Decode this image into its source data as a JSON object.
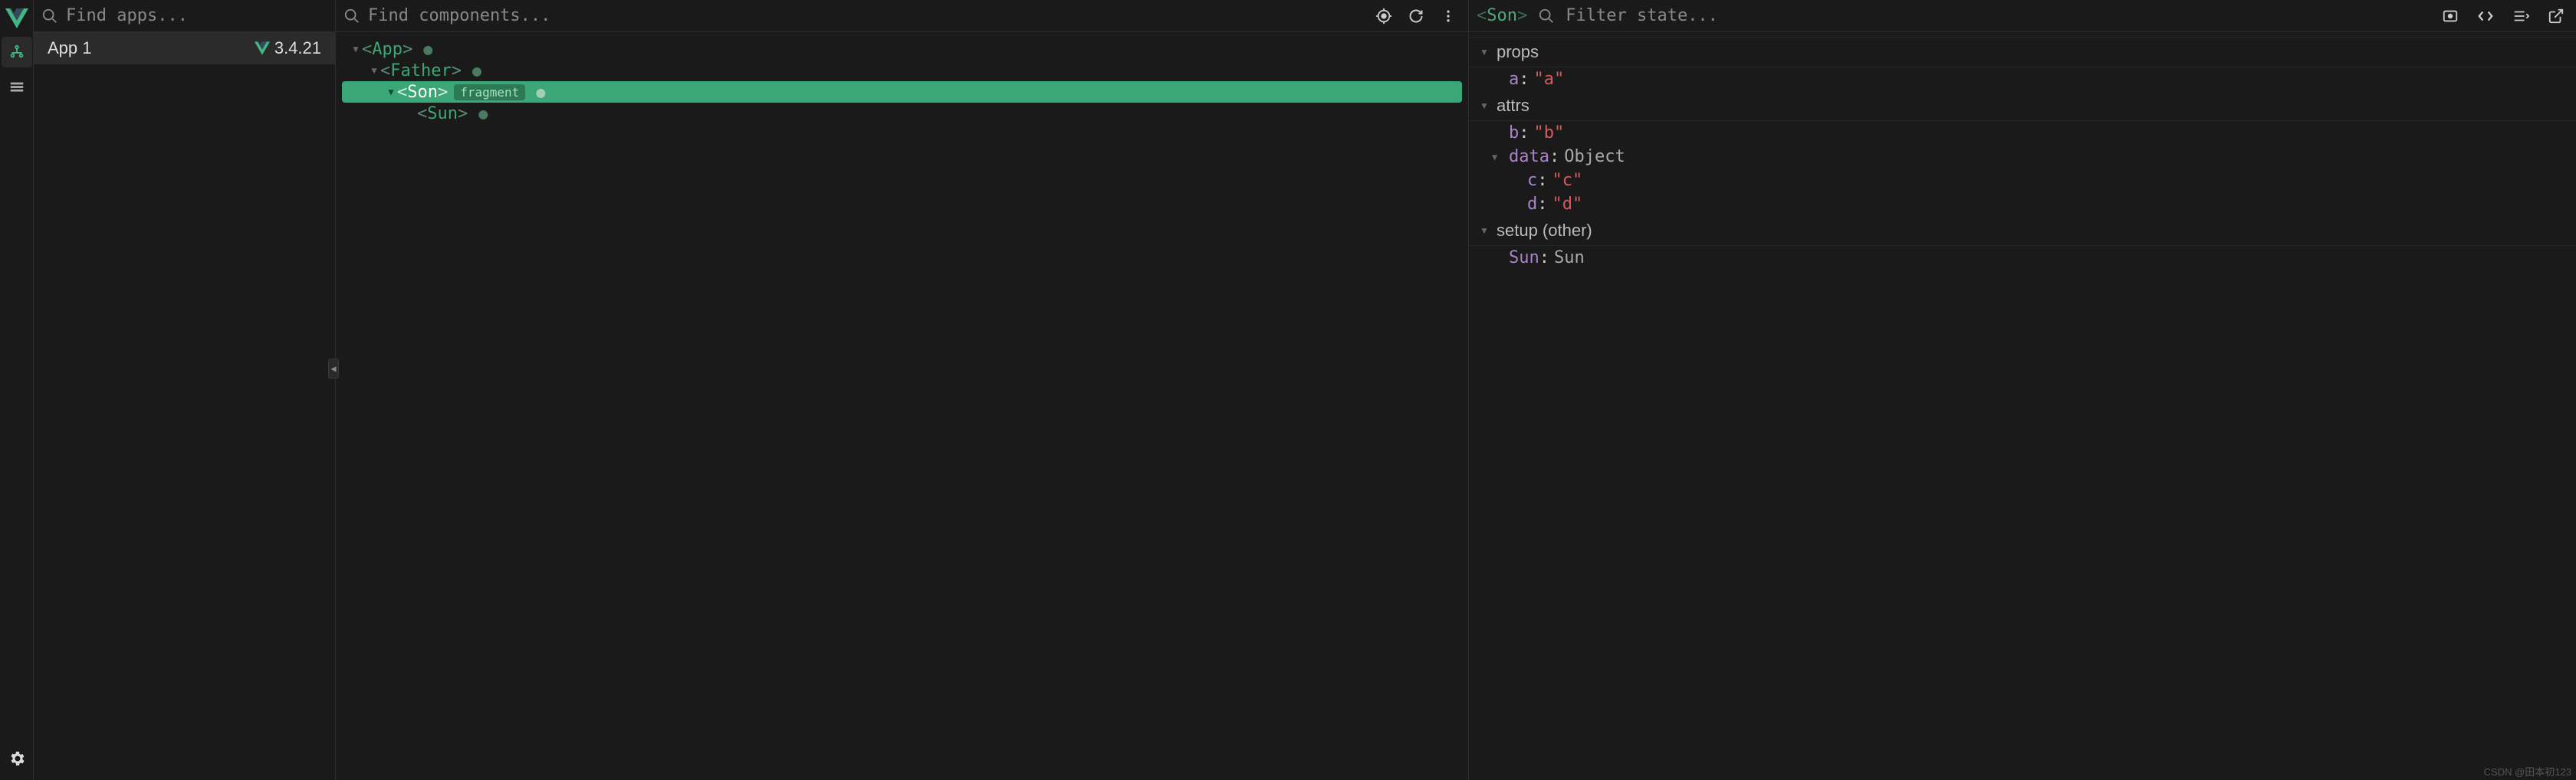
{
  "apps_search_placeholder": "Find apps...",
  "components_search_placeholder": "Find components...",
  "state_filter_placeholder": "Filter state...",
  "app": {
    "name": "App 1",
    "version": "3.4.21"
  },
  "tree": {
    "n0": {
      "name": "App"
    },
    "n1": {
      "name": "Father"
    },
    "n2": {
      "name": "Son",
      "badge": "fragment"
    },
    "n3": {
      "name": "Sun"
    }
  },
  "selected_component": "Son",
  "state": {
    "sections": {
      "props": {
        "label": "props"
      },
      "attrs": {
        "label": "attrs"
      },
      "setup": {
        "label": "setup (other)"
      }
    },
    "props": {
      "a": {
        "key": "a",
        "val": "\"a\""
      }
    },
    "attrs": {
      "b": {
        "key": "b",
        "val": "\"b\""
      },
      "data": {
        "key": "data",
        "val": "Object"
      },
      "c": {
        "key": "c",
        "val": "\"c\""
      },
      "d": {
        "key": "d",
        "val": "\"d\""
      }
    },
    "setup": {
      "Sun": {
        "key": "Sun",
        "val": "Sun"
      }
    }
  },
  "watermark": "CSDN @田本初123"
}
